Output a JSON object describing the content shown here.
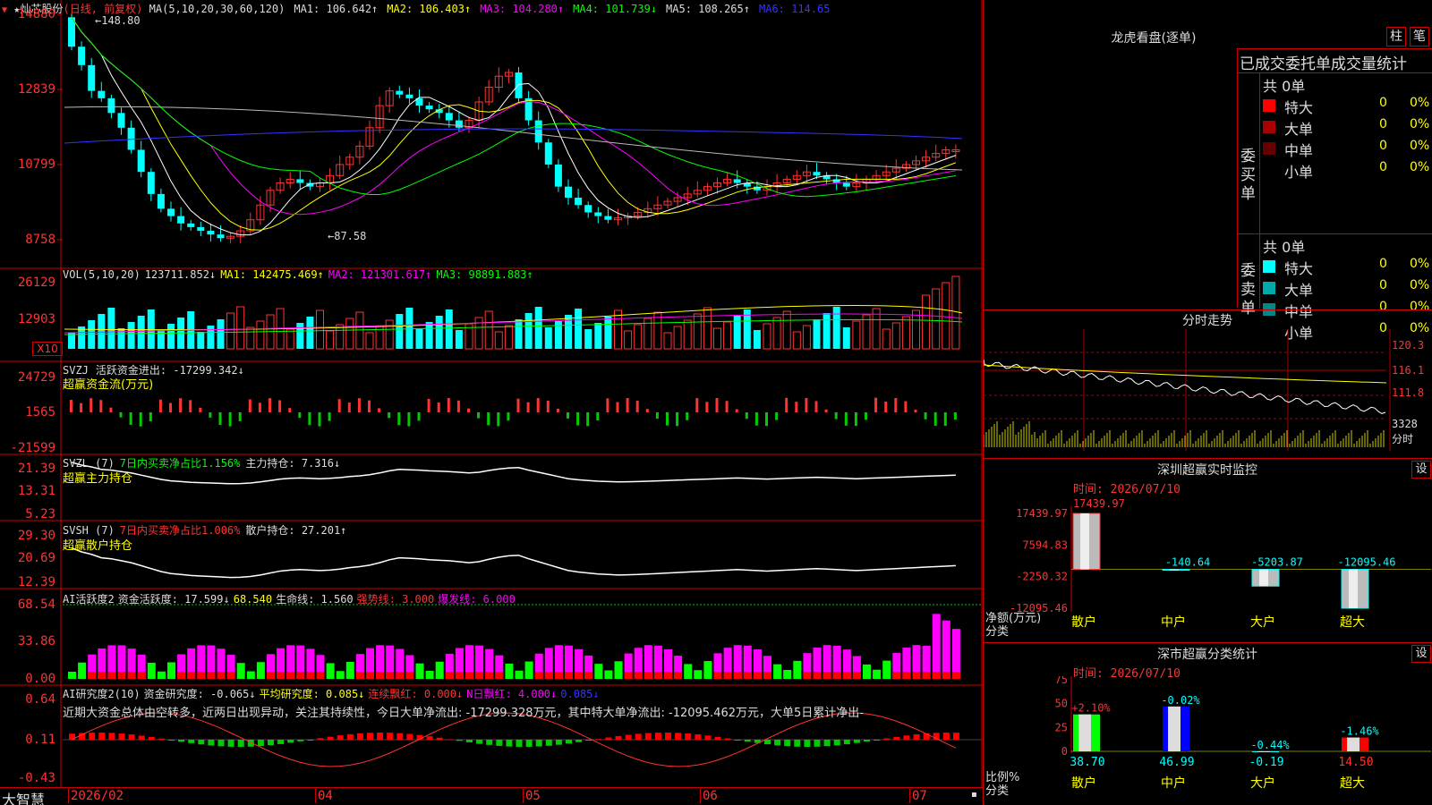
{
  "header": {
    "stock_name": "★灿芯股份",
    "period_note": "(日线, 前复权)",
    "ma_legend": [
      {
        "text": "MA(5,10,20,30,60,120)",
        "color": "#dddddd"
      },
      {
        "text": "MA1: 106.642↑",
        "color": "#dddddd"
      },
      {
        "text": "MA2: 106.403↑",
        "color": "#ffff00"
      },
      {
        "text": "MA3: 104.280↑",
        "color": "#ff00ff"
      },
      {
        "text": "MA4: 101.739↓",
        "color": "#00ff00"
      },
      {
        "text": "MA5: 108.265↑",
        "color": "#dddddd"
      },
      {
        "text": "MA6: 114.65",
        "color": "#3333ff"
      }
    ],
    "high_label": "148.80",
    "low_label": "87.58"
  },
  "price_axis": [
    "14880",
    "12839",
    "10799",
    "8758"
  ],
  "vol_panel": {
    "legend": [
      {
        "text": "VOL(5,10,20)",
        "color": "#dddddd"
      },
      {
        "text": "123711.852↓",
        "color": "#dddddd"
      },
      {
        "text": "MA1: 142475.469↑",
        "color": "#ffff00"
      },
      {
        "text": "MA2: 121301.617↑",
        "color": "#ff00ff"
      },
      {
        "text": "MA3: 98891.883↑",
        "color": "#00ff00"
      }
    ],
    "axis": [
      "26129",
      "12903"
    ],
    "unit": "X10"
  },
  "svzj_panel": {
    "legend": [
      {
        "text": "SVZJ",
        "color": "#dddddd"
      },
      {
        "text": "活跃资金进出: -17299.342↓",
        "color": "#dddddd"
      }
    ],
    "subtitle": "超赢资金流(万元)",
    "axis": [
      "24729",
      "1565",
      "-21599"
    ]
  },
  "svzl_panel": {
    "legend": [
      {
        "text": "SVZL (7)",
        "color": "#dddddd"
      },
      {
        "text": "7日内买卖净占比1.156%",
        "color": "#00ff00"
      },
      {
        "text": "主力持仓: 7.316↓",
        "color": "#dddddd"
      }
    ],
    "subtitle": "超赢主力持仓",
    "axis": [
      "21.39",
      "13.31",
      "5.23"
    ]
  },
  "svsh_panel": {
    "legend": [
      {
        "text": "SVSH (7)",
        "color": "#dddddd"
      },
      {
        "text": "7日内买卖净占比1.006%",
        "color": "#ff3333"
      },
      {
        "text": "散户持仓: 27.201↑",
        "color": "#dddddd"
      }
    ],
    "subtitle": "超赢散户持仓",
    "axis": [
      "29.30",
      "20.69",
      "12.39"
    ]
  },
  "ai_active_panel": {
    "legend": [
      {
        "text": "AI活跃度2",
        "color": "#dddddd"
      },
      {
        "text": "资金活跃度: 17.599↓",
        "color": "#dddddd"
      },
      {
        "text": "68.540",
        "color": "#ffff00"
      },
      {
        "text": "生命线: 1.560",
        "color": "#dddddd"
      },
      {
        "text": "强势线: 3.000",
        "color": "#ff3333"
      },
      {
        "text": "爆发线: 6.000",
        "color": "#ff00ff"
      }
    ],
    "axis": [
      "68.54",
      "33.86",
      "0.00"
    ]
  },
  "ai_research_panel": {
    "legend": [
      {
        "text": "AI研究度2(10)",
        "color": "#dddddd"
      },
      {
        "text": "资金研究度: -0.065↓",
        "color": "#dddddd"
      },
      {
        "text": "平均研究度: 0.085↓",
        "color": "#ffff00"
      },
      {
        "text": "连续飘红: 0.000↓",
        "color": "#ff3333"
      },
      {
        "text": "N日飘红: 4.000↓",
        "color": "#ff00ff"
      },
      {
        "text": "0.085↓",
        "color": "#3333ff"
      }
    ],
    "commentary": "近期大资金总体由空转多，近两日出现异动，关注其持续性，今日大单净流出: -17299.328万元，其中特大单净流出: -12095.462万元，大单5日累计净出-",
    "axis": [
      "0.64",
      "0.11",
      "-0.43"
    ]
  },
  "date_axis": {
    "brand": "大智慧",
    "labels": [
      "2026/02",
      "04",
      "05",
      "06",
      "07"
    ]
  },
  "lhb": {
    "title": "龙虎看盘(逐单)",
    "btn_bar": "柱",
    "btn_pen": "笔",
    "header": "已成交委托单成交量统计",
    "buy_label": "委买单",
    "sell_label": "委卖单",
    "buy_total": "共 0单",
    "sell_total": "共 0单",
    "buy_rows": [
      {
        "name": "特大",
        "color": "#ff0000",
        "count": "0",
        "pct": "0%"
      },
      {
        "name": "大单",
        "color": "#aa0000",
        "count": "0",
        "pct": "0%"
      },
      {
        "name": "中单",
        "color": "#660000",
        "count": "0",
        "pct": "0%"
      },
      {
        "name": "小单",
        "color": "#000000",
        "count": "0",
        "pct": "0%"
      }
    ],
    "sell_rows": [
      {
        "name": "特大",
        "color": "#00ffff",
        "count": "0",
        "pct": "0%"
      },
      {
        "name": "大单",
        "color": "#00aaaa",
        "count": "0",
        "pct": "0%"
      },
      {
        "name": "中单",
        "color": "#008888",
        "count": "0",
        "pct": "0%"
      },
      {
        "name": "小单",
        "color": "#000000",
        "count": "0",
        "pct": "0%"
      }
    ]
  },
  "intraday": {
    "title": "分时走势",
    "price_labels": [
      "120.3",
      "116.1",
      "111.8"
    ],
    "volume_label": "3328",
    "unit_label": "分时"
  },
  "monitor": {
    "title": "深圳超赢实时监控",
    "gear": "设",
    "time": "时间: 2026/07/10",
    "top_value": "17439.97",
    "axis": [
      "17439.97",
      "7594.83",
      "-2250.32",
      "-12095.46"
    ],
    "ylabel": "净额(万元)",
    "xlabel": "分类",
    "bars": [
      {
        "cat": "散户",
        "value": "17439.97"
      },
      {
        "cat": "中户",
        "value": "-140.64"
      },
      {
        "cat": "大户",
        "value": "-5203.87"
      },
      {
        "cat": "超大",
        "value": "-12095.46"
      }
    ]
  },
  "classify": {
    "title": "深市超赢分类统计",
    "gear": "设",
    "time": "时间: 2026/07/10",
    "axis": [
      "75",
      "50",
      "25",
      "0"
    ],
    "ylabel": "比例%",
    "xlabel": "分类",
    "bars": [
      {
        "cat": "散户",
        "value": "38.70",
        "change": "+2.10%"
      },
      {
        "cat": "中户",
        "value": "46.99",
        "change": "-0.02%"
      },
      {
        "cat": "大户",
        "value": "-0.19",
        "change": "-0.44%"
      },
      {
        "cat": "超大",
        "value": "14.50",
        "change": "-1.46%"
      }
    ]
  },
  "chart_data": [
    {
      "type": "bar",
      "title": "深圳超赢实时监控",
      "categories": [
        "散户",
        "中户",
        "大户",
        "超大"
      ],
      "values": [
        17439.97,
        -140.64,
        -5203.87,
        -12095.46
      ],
      "ylabel": "净额(万元)",
      "xlabel": "分类",
      "ylim": [
        -12095.46,
        17439.97
      ]
    },
    {
      "type": "bar",
      "title": "深市超赢分类统计",
      "categories": [
        "散户",
        "中户",
        "大户",
        "超大"
      ],
      "values": [
        38.7,
        46.99,
        -0.19,
        14.5
      ],
      "ylabel": "比例%",
      "xlabel": "分类",
      "ylim": [
        0,
        75
      ]
    }
  ]
}
